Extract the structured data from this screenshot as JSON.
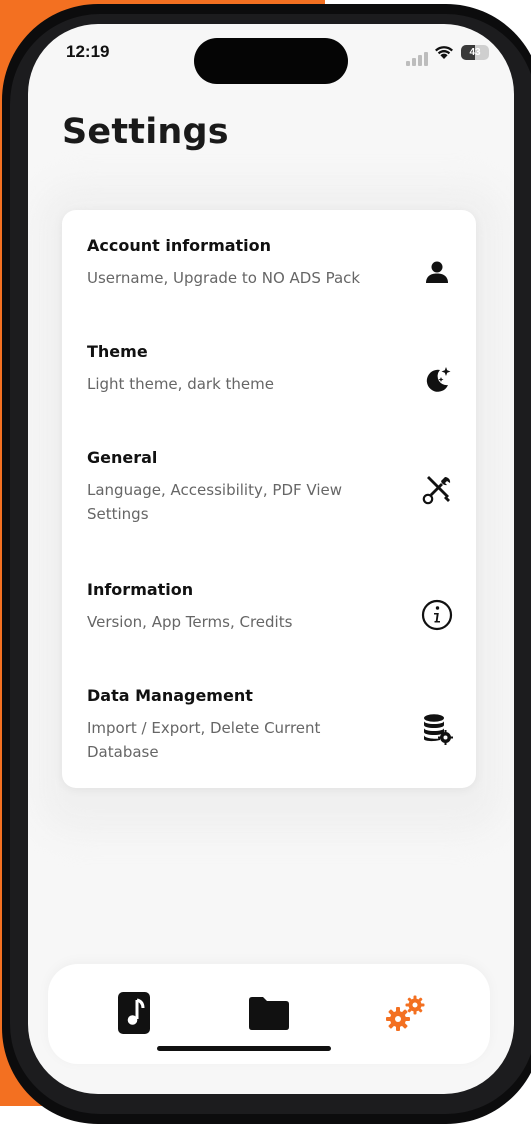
{
  "status_bar": {
    "time": "12:19",
    "battery": "43"
  },
  "title": "Settings",
  "items": [
    {
      "title": "Account information",
      "subtitle": "Username, Upgrade to NO ADS Pack",
      "icon": "user-icon"
    },
    {
      "title": "Theme",
      "subtitle": "Light theme, dark theme",
      "icon": "moon-stars-icon"
    },
    {
      "title": "General",
      "subtitle": "Language, Accessibility, PDF View Settings",
      "icon": "tools-icon"
    },
    {
      "title": "Information",
      "subtitle": "Version, App Terms, Credits",
      "icon": "info-icon"
    },
    {
      "title": "Data Management",
      "subtitle": "Import / Export, Delete Current Database",
      "icon": "database-gear-icon"
    }
  ],
  "tabs": [
    {
      "icon": "music-file-icon",
      "active": false
    },
    {
      "icon": "folder-icon",
      "active": false
    },
    {
      "icon": "gears-icon",
      "active": true
    }
  ],
  "colors": {
    "accent": "#f37021",
    "text": "#111111",
    "subtext": "#666666"
  }
}
